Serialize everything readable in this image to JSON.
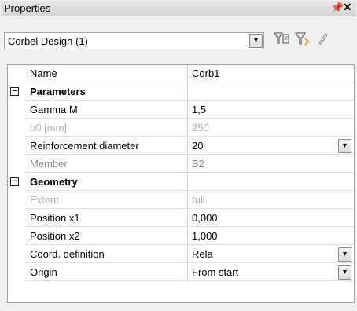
{
  "window": {
    "title": "Properties",
    "pin_glyph": "ᵖ",
    "close_glyph": "✕"
  },
  "toolbar": {
    "object_selector_value": "Corbel Design (1)",
    "dropdown_glyph": "▾",
    "icons": [
      "filter-select-icon",
      "filter-add-icon",
      "edit-pencil-icon"
    ]
  },
  "grid": {
    "rows": [
      {
        "type": "property",
        "name": "Name",
        "value": "Corb1"
      },
      {
        "type": "category",
        "name": "Parameters",
        "expander": "−"
      },
      {
        "type": "property",
        "name": "Gamma M",
        "value": "1,5"
      },
      {
        "type": "property",
        "name": "b0 [mm]",
        "value": "250",
        "faded": true
      },
      {
        "type": "property",
        "name": "Reinforcement diameter",
        "value": "20",
        "dropdown": true
      },
      {
        "type": "property",
        "name": "Member",
        "value": "B2",
        "readonly": true
      },
      {
        "type": "category",
        "name": "Geometry",
        "expander": "−"
      },
      {
        "type": "property",
        "name": "Extent",
        "value": "full",
        "faded": true
      },
      {
        "type": "property",
        "name": "Position x1",
        "value": "0,000"
      },
      {
        "type": "property",
        "name": "Position x2",
        "value": "1,000"
      },
      {
        "type": "property",
        "name": "Coord. definition",
        "value": "Rela",
        "dropdown": true
      },
      {
        "type": "property",
        "name": "Origin",
        "value": "From start",
        "dropdown": true
      }
    ]
  }
}
